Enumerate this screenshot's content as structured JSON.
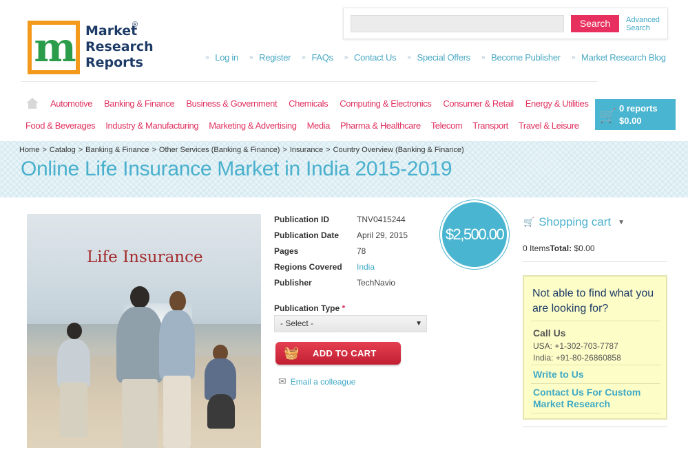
{
  "logo": {
    "letter": "m",
    "line1": "Market",
    "line2": "Research",
    "line3": "Reports",
    "reg": "®"
  },
  "search": {
    "placeholder": "",
    "button_label": "Search",
    "advanced_line1": "Advanced",
    "advanced_line2": "Search"
  },
  "top_links": [
    "Log in",
    "Register",
    "FAQs",
    "Contact Us",
    "Special Offers",
    "Become Publisher",
    "Market Research Blog"
  ],
  "nav_row1": [
    "Automotive",
    "Banking & Finance",
    "Business & Government",
    "Chemicals",
    "Computing & Electronics",
    "Consumer & Retail",
    "Energy & Utilities"
  ],
  "nav_row2": [
    "Food & Beverages",
    "Industry & Manufacturing",
    "Marketing & Advertising",
    "Media",
    "Pharma & Healthcare",
    "Telecom",
    "Transport",
    "Travel & Leisure"
  ],
  "header_cart": {
    "reports": "0 reports",
    "amount": "$0.00"
  },
  "breadcrumb": [
    "Home",
    "Catalog",
    "Banking & Finance",
    "Other Services (Banking & Finance)",
    "Insurance",
    "Country Overview (Banking & Finance)"
  ],
  "breadcrumb_sep": ">",
  "page_title": "Online Life Insurance Market in India 2015-2019",
  "product_image": {
    "caption": "Life Insurance"
  },
  "details": [
    {
      "label": "Publication ID",
      "value": "TNV0415244"
    },
    {
      "label": "Publication Date",
      "value": "April 29, 2015"
    },
    {
      "label": "Pages",
      "value": "78"
    },
    {
      "label": "Regions Covered",
      "value": "India"
    },
    {
      "label": "Publisher",
      "value": "TechNavio"
    }
  ],
  "publication_type": {
    "label": "Publication Type",
    "required_mark": "*",
    "selected": "- Select -"
  },
  "add_to_cart": "ADD TO CART",
  "email_colleague": "Email a colleague",
  "price": "$2,500.00",
  "sidebar_cart": {
    "title": "Shopping cart",
    "items": "0 Items",
    "total_label": "Total:",
    "total_value": "$0.00"
  },
  "help": {
    "title": "Not able to find what you are looking for?",
    "call_us": "Call Us",
    "phone_usa": "USA: +1-302-703-7787",
    "phone_india": "India: +91-80-26860858",
    "write_to_us": "Write to Us",
    "custom": "Contact Us For Custom Market Research"
  },
  "colors": {
    "accent_pink": "#e0325f",
    "accent_blue": "#4ab5d0",
    "navy": "#1d3b66",
    "help_bg": "#fdfdc8"
  }
}
